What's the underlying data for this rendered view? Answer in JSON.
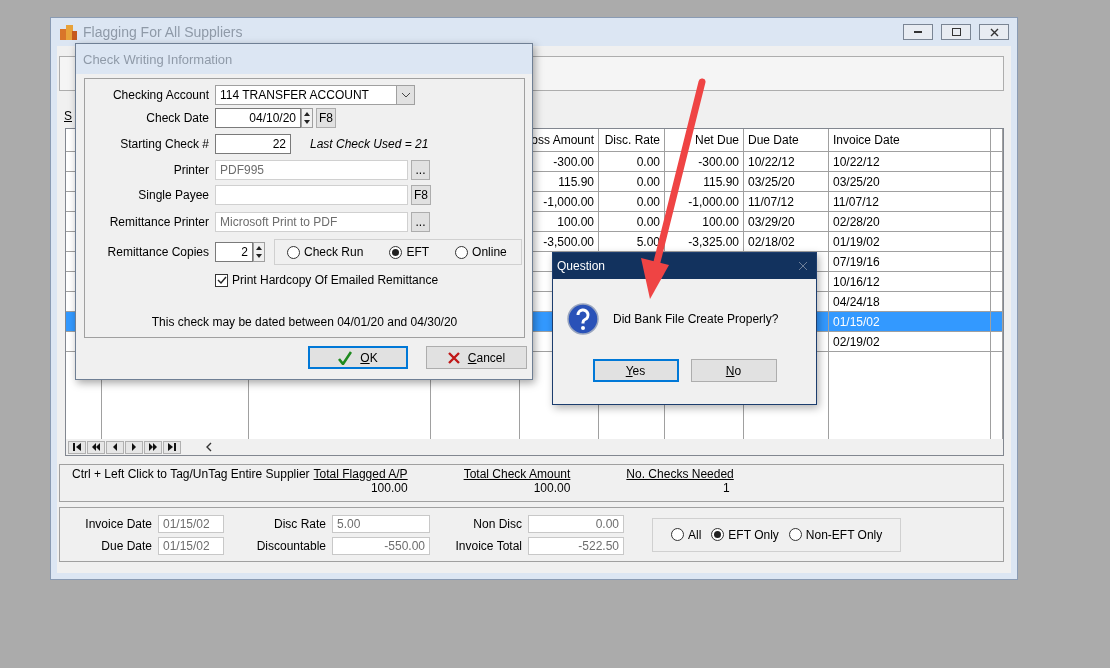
{
  "window": {
    "title": "Flagging For All Suppliers"
  },
  "section_label": "S",
  "table": {
    "columns": [
      "oss Amount",
      "Disc. Rate",
      "Net Due",
      "Due Date",
      "Invoice Date"
    ],
    "rows": [
      {
        "selected": false,
        "cells": [
          "-300.00",
          "0.00",
          "-300.00",
          "10/22/12",
          "10/22/12"
        ]
      },
      {
        "selected": false,
        "cells": [
          "115.90",
          "0.00",
          "115.90",
          "03/25/20",
          "03/25/20"
        ]
      },
      {
        "selected": false,
        "cells": [
          "-1,000.00",
          "0.00",
          "-1,000.00",
          "11/07/12",
          "11/07/12"
        ]
      },
      {
        "selected": false,
        "cells": [
          "100.00",
          "0.00",
          "100.00",
          "03/29/20",
          "02/28/20"
        ]
      },
      {
        "selected": false,
        "cells": [
          "-3,500.00",
          "5.00",
          "-3,325.00",
          "02/18/02",
          "01/19/02"
        ]
      },
      {
        "selected": false,
        "cells": [
          "",
          "",
          "",
          "",
          "07/19/16"
        ]
      },
      {
        "selected": false,
        "cells": [
          "",
          "",
          "",
          "",
          "10/16/12"
        ]
      },
      {
        "selected": false,
        "cells": [
          "",
          "",
          "",
          "",
          "04/24/18"
        ]
      },
      {
        "selected": true,
        "cells": [
          "",
          "",
          "",
          "",
          "01/15/02"
        ]
      },
      {
        "selected": false,
        "cells": [
          "",
          "",
          "",
          "",
          "02/19/02"
        ]
      }
    ]
  },
  "summary": {
    "hint": "Ctrl + Left Click to Tag/UnTag Entire Supplier",
    "totals": [
      {
        "label": "Total Flagged A/P",
        "value": "100.00"
      },
      {
        "label": "Total Check Amount",
        "value": "100.00"
      },
      {
        "label": "No. Checks Needed",
        "value": "1"
      }
    ]
  },
  "details": {
    "fields": [
      {
        "label": "Invoice Date",
        "value": "01/15/02",
        "kind": "date"
      },
      {
        "label": "Disc Rate",
        "value": "5.00",
        "kind": "date"
      },
      {
        "label": "Non Disc",
        "value": "0.00",
        "kind": "number"
      },
      {
        "label": "Due Date",
        "value": "01/15/02",
        "kind": "date"
      },
      {
        "label": "Discountable",
        "value": "-550.00",
        "kind": "number"
      },
      {
        "label": "Invoice Total",
        "value": "-522.50",
        "kind": "number"
      }
    ],
    "filter": [
      {
        "label": "All",
        "selected": false
      },
      {
        "label": "EFT Only",
        "selected": true
      },
      {
        "label": "Non-EFT Only",
        "selected": false
      }
    ]
  },
  "check_dialog": {
    "title": "Check Writing Information",
    "checking_account": {
      "label": "Checking Account",
      "value": "114  TRANSFER ACCOUNT"
    },
    "check_date": {
      "label": "Check Date",
      "value": "04/10/20",
      "button": "F8"
    },
    "starting_check": {
      "label": "Starting Check #",
      "value": "22",
      "note": "Last Check Used = 21"
    },
    "printer": {
      "label": "Printer",
      "value": "PDF995",
      "button": "..."
    },
    "single_payee": {
      "label": "Single Payee",
      "button": "F8"
    },
    "remittance_printer": {
      "label": "Remittance Printer",
      "value": "Microsoft Print to PDF",
      "button": "..."
    },
    "remittance_copies": {
      "label": "Remittance Copies",
      "value": "2"
    },
    "method": [
      {
        "label": "Check Run",
        "selected": false
      },
      {
        "label": "EFT",
        "selected": true
      },
      {
        "label": "Online",
        "selected": false
      }
    ],
    "hardcopy": {
      "label": "Print Hardcopy Of Emailed Remittance",
      "checked": true
    },
    "note": "This check may be dated between 04/01/20 and 04/30/20",
    "buttons": [
      {
        "label": "OK",
        "kind": "ok",
        "default": true
      },
      {
        "label": "Cancel",
        "kind": "cancel",
        "default": false
      }
    ]
  },
  "question_dialog": {
    "title": "Question",
    "message": "Did Bank File Create Properly?",
    "buttons": [
      {
        "label": "Yes",
        "default": true
      },
      {
        "label": "No",
        "default": false
      }
    ]
  }
}
